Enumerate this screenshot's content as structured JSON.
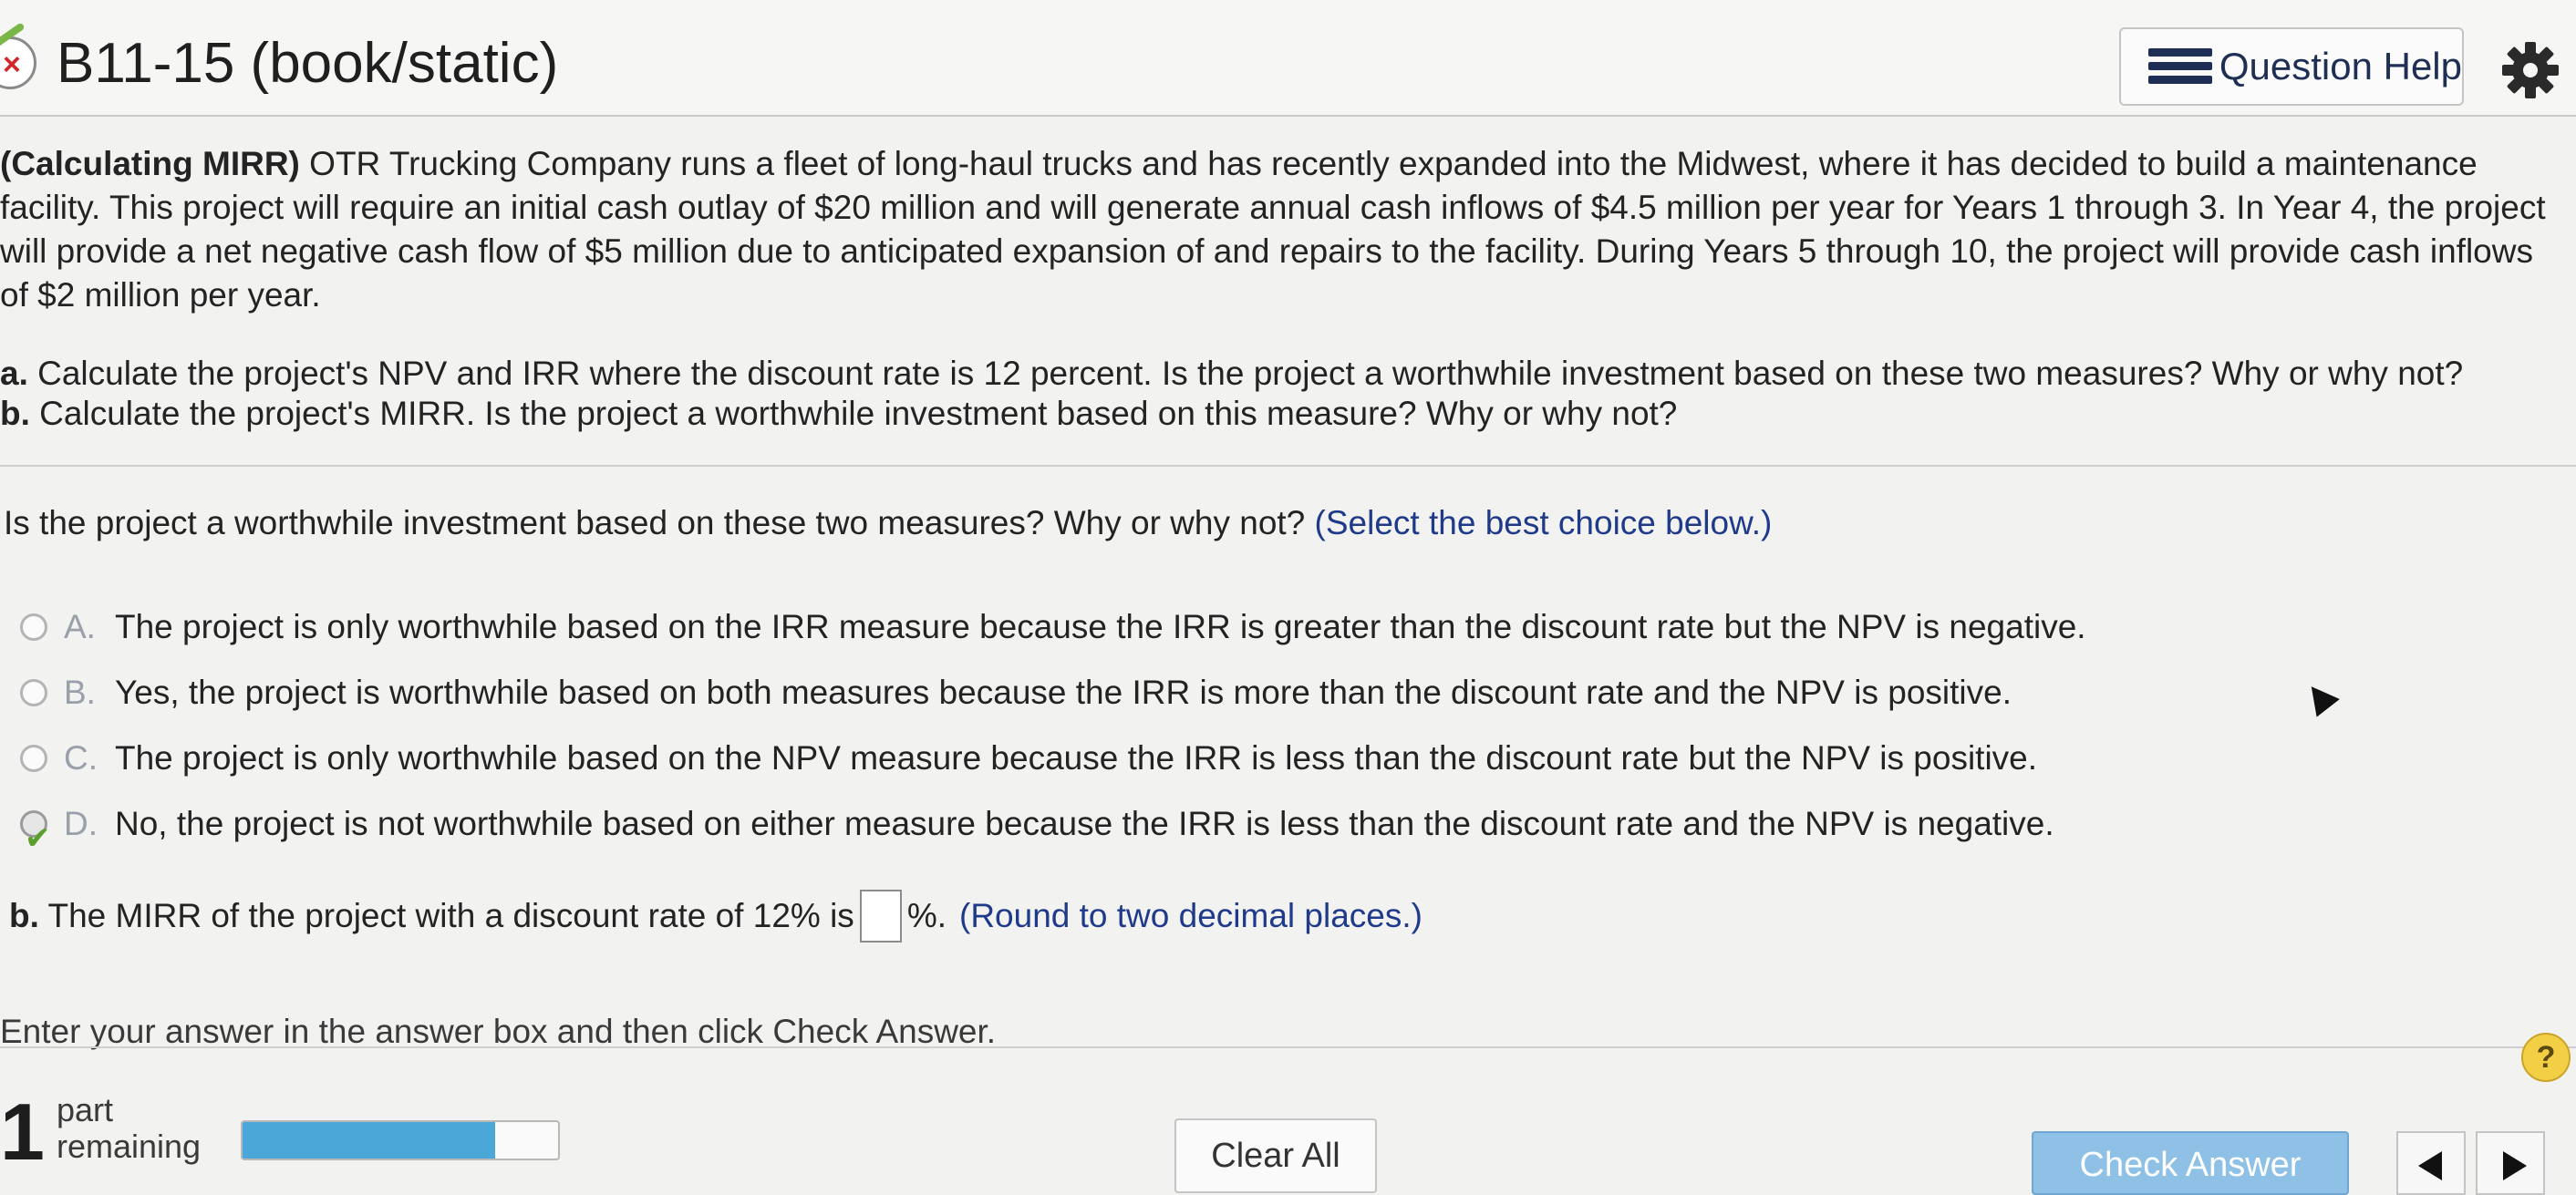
{
  "header": {
    "title": "B11-15 (book/static)",
    "help_label": "Question Help",
    "status_icon": "x-mark-icon",
    "settings_icon": "gear-icon"
  },
  "problem": {
    "lead_bold": "(Calculating MIRR)",
    "body": " OTR Trucking Company runs a fleet of long-haul trucks and has recently expanded into the Midwest, where it has decided to build a maintenance facility. This project will require an initial cash outlay of $20 million and will generate annual cash inflows of $4.5 million per year for Years 1 through 3. In Year 4, the project will provide a net negative cash flow of $5 million due to anticipated expansion of and repairs to the facility. During Years 5 through 10, the project will provide cash inflows of $2 million per year.",
    "part_a_label": "a.",
    "part_a_text": " Calculate the project's NPV and IRR where the discount rate is 12 percent. Is the project a worthwhile investment based on these two measures? Why or why not?",
    "part_b_label": "b.",
    "part_b_text": " Calculate the project's MIRR. Is the project a worthwhile investment based on this measure? Why or why not?"
  },
  "question": {
    "text": "Is the project a worthwhile investment based on these two measures? Why or why not?",
    "hint": "(Select the best choice below.)",
    "choices": [
      {
        "letter": "A.",
        "text": "The project is only worthwhile based on the IRR measure because the IRR is greater than the discount rate but the NPV is negative."
      },
      {
        "letter": "B.",
        "text": "Yes, the project is worthwhile based on both measures because the IRR is more than the discount rate and the NPV is positive."
      },
      {
        "letter": "C.",
        "text": "The project is only worthwhile based on the NPV measure because the IRR is less than the discount rate but the NPV is positive."
      },
      {
        "letter": "D.",
        "text": "No, the project is not worthwhile based on either measure because the IRR is less than the discount rate and the NPV is negative."
      }
    ],
    "selected": "D."
  },
  "part_b": {
    "label": "b.",
    "prefix": " The MIRR of the project with a discount rate of 12% is",
    "answer_value": "",
    "suffix": "%.",
    "hint": "(Round to two decimal places.)"
  },
  "instruction": "Enter your answer in the answer box and then click Check Answer.",
  "footer": {
    "parts_count": "1",
    "parts_line1": "part",
    "parts_line2": "remaining",
    "progress_fraction": 0.8,
    "clear_label": "Clear All",
    "check_label": "Check Answer",
    "help_icon": "?"
  },
  "colors": {
    "accent_blue": "#1f3a8a",
    "progress_fill": "#4aa7d8",
    "check_button": "#8fc0e6",
    "correct_check": "#5aa02c",
    "error_x": "#d0282a"
  }
}
